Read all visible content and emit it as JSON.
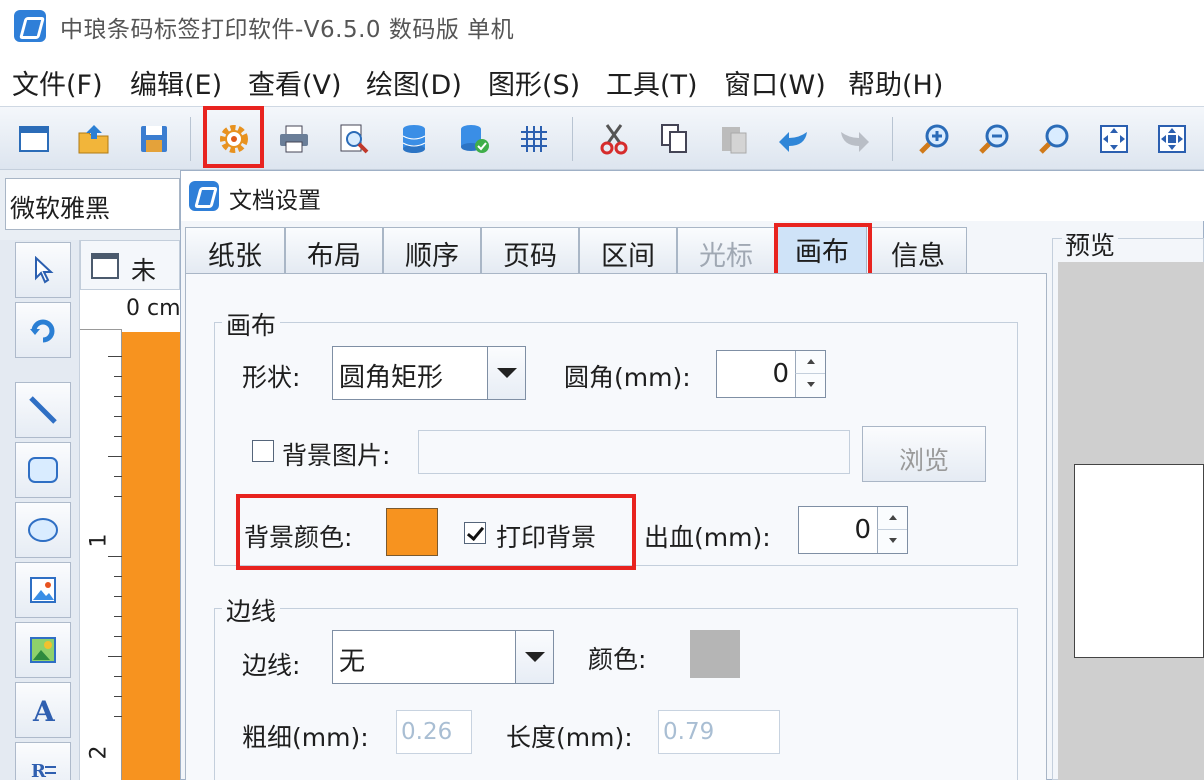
{
  "app": {
    "title": "中琅条码标签打印软件-V6.5.0 数码版 单机"
  },
  "menu": [
    {
      "label": "文件(F)",
      "key": "F"
    },
    {
      "label": "编辑(E)",
      "key": "E"
    },
    {
      "label": "查看(V)",
      "key": "V"
    },
    {
      "label": "绘图(D)",
      "key": "D"
    },
    {
      "label": "图形(S)",
      "key": "S"
    },
    {
      "label": "工具(T)",
      "key": "T"
    },
    {
      "label": "窗口(W)",
      "key": "W"
    },
    {
      "label": "帮助(H)",
      "key": "H"
    }
  ],
  "toolbar": {
    "buttons": [
      "new-icon",
      "open-icon",
      "save-icon",
      "document-settings-icon",
      "print-icon",
      "print-preview-icon",
      "database-icon",
      "database-connect-icon",
      "grid-icon",
      "cut-icon",
      "copy-icon",
      "paste-icon",
      "undo-icon",
      "redo-icon",
      "zoom-in-icon",
      "zoom-out-icon",
      "zoom-icon",
      "fit-page-icon",
      "actual-size-icon"
    ]
  },
  "font_bar": {
    "font_name": "微软雅黑"
  },
  "document": {
    "tab_label": "未命",
    "ruler_zero": "0 cm",
    "ruler_one": "1",
    "ruler_two": "2",
    "canvas_color": "#f7931f"
  },
  "dialog": {
    "title": "文档设置",
    "tabs": [
      {
        "label": "纸张",
        "state": "normal"
      },
      {
        "label": "布局",
        "state": "normal"
      },
      {
        "label": "顺序",
        "state": "normal"
      },
      {
        "label": "页码",
        "state": "normal"
      },
      {
        "label": "区间",
        "state": "normal"
      },
      {
        "label": "光标",
        "state": "disabled"
      },
      {
        "label": "画布",
        "state": "active"
      },
      {
        "label": "信息",
        "state": "normal"
      }
    ],
    "canvas_group": {
      "title": "画布",
      "shape_label": "形状:",
      "shape_value": "圆角矩形",
      "corner_label": "圆角(mm):",
      "corner_value": "0",
      "bg_image_label": "背景图片:",
      "bg_image_checked": false,
      "browse_label": "浏览",
      "bg_color_label": "背景颜色:",
      "bg_color": "#f7931f",
      "print_bg_label": "打印背景",
      "print_bg_checked": true,
      "bleed_label": "出血(mm):",
      "bleed_value": "0"
    },
    "border_group": {
      "title": "边线",
      "border_label": "边线:",
      "border_value": "无",
      "color_label": "颜色:",
      "color": "#b5b5b5",
      "thickness_label": "粗细(mm):",
      "thickness_value": "0.26",
      "length_label": "长度(mm):",
      "length_value": "0.79"
    },
    "preview_label": "预览"
  },
  "highlight_color": "#e8231f"
}
